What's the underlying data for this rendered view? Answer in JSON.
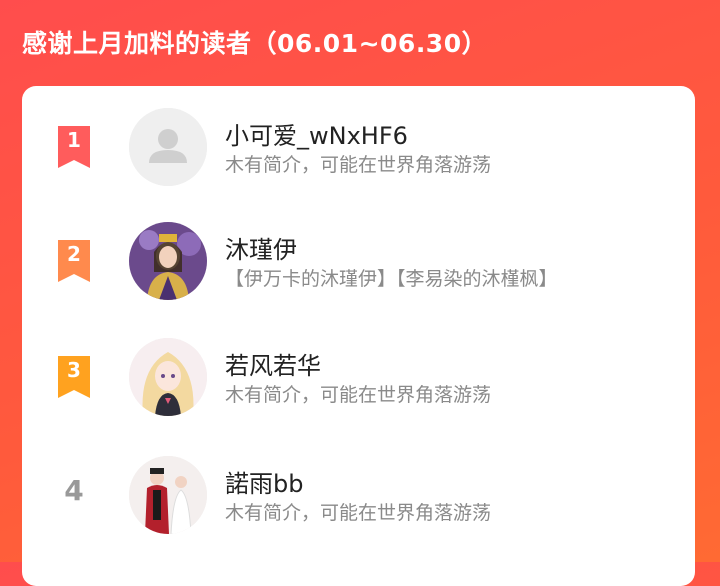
{
  "header": {
    "title": "感谢上月加料的读者（06.01~06.30）"
  },
  "colors": {
    "background_start": "#ff4d4d",
    "background_end": "#ff6a33",
    "rank1": "#ff5c5c",
    "rank2": "#ff8a4d",
    "rank3": "#ffa21f",
    "rank_plain": "#999999"
  },
  "readers": [
    {
      "rank": "1",
      "name": "小可爱_wNxHF6",
      "bio": "木有简介，可能在世界角落游荡",
      "avatar": "default-user-avatar"
    },
    {
      "rank": "2",
      "name": "沐瑾伊",
      "bio": "【伊万卡的沐瑾伊】【李易染的沐槿枫】",
      "avatar": "illustrated-queen-avatar"
    },
    {
      "rank": "3",
      "name": "若风若华",
      "bio": "木有简介，可能在世界角落游荡",
      "avatar": "illustrated-girl-avatar"
    },
    {
      "rank": "4",
      "name": "諾雨bb",
      "bio": "木有简介，可能在世界角落游荡",
      "avatar": "illustrated-couple-avatar"
    }
  ]
}
